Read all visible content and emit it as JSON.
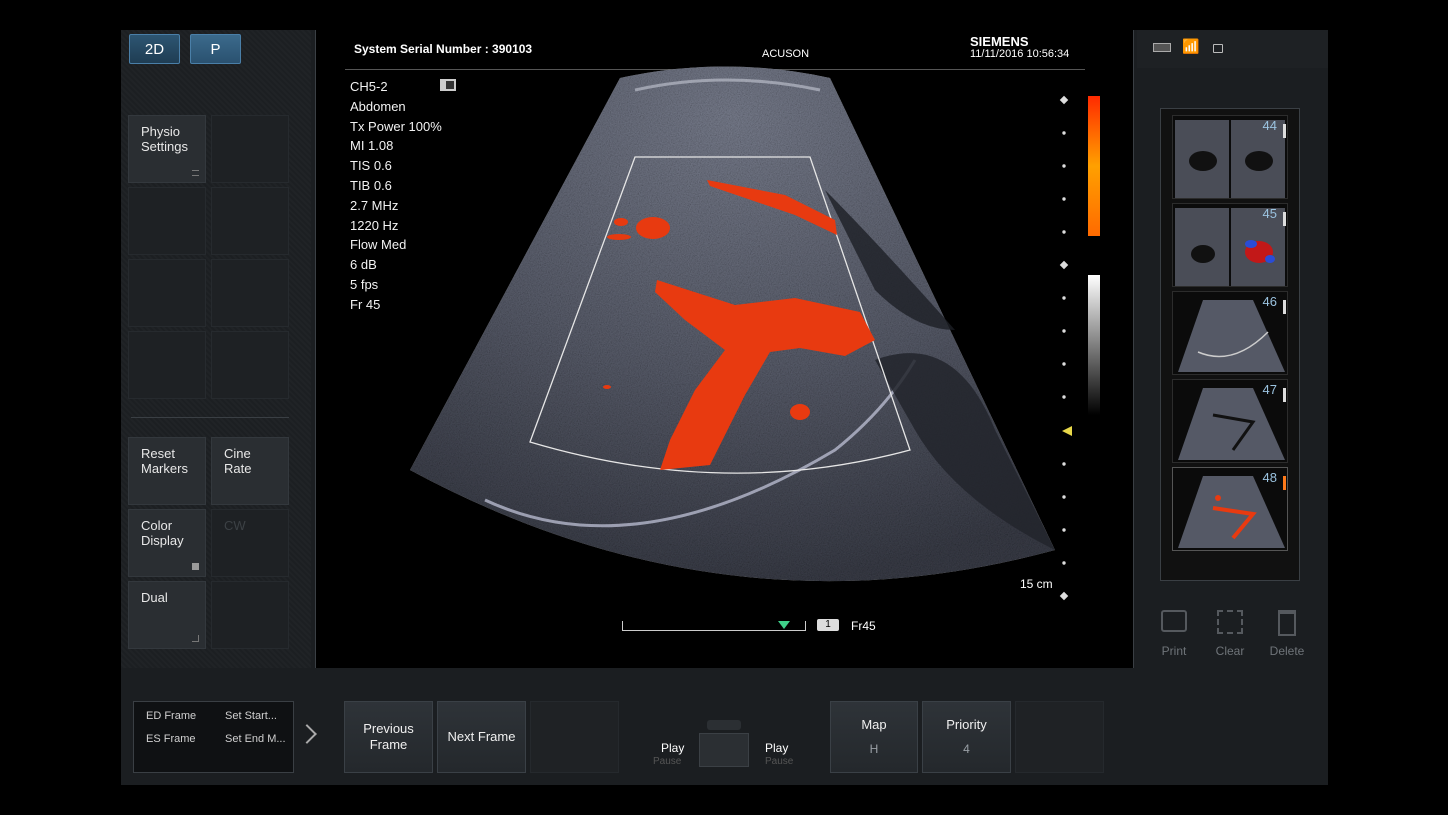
{
  "top_left": {
    "mode_2d": "2D",
    "mode_p": "P"
  },
  "left_panel": {
    "physio": "Physio Settings",
    "reset_markers": "Reset Markers",
    "cine_rate": "Cine Rate",
    "color_display": "Color Display",
    "cw": "CW",
    "dual": "Dual"
  },
  "header": {
    "serial": "System Serial Number : 390103",
    "product": "ACUSON",
    "brand": "SIEMENS",
    "datetime": "11/11/2016 10:56:34"
  },
  "params": [
    "CH5-2",
    "Abdomen",
    "Tx Power 100%",
    "MI 1.08",
    "TIS 0.6",
    "TIB 0.6",
    "2.7 MHz",
    "1220 Hz",
    "Flow Med",
    "6 dB",
    "5 fps",
    "Fr 45"
  ],
  "depth_label": "15 cm",
  "cine": {
    "marker": "1",
    "frame_label": "Fr45"
  },
  "thumbnails": [
    {
      "num": "44",
      "kind": "dual-bw"
    },
    {
      "num": "45",
      "kind": "dual-color"
    },
    {
      "num": "46",
      "kind": "liver-bw"
    },
    {
      "num": "47",
      "kind": "liver-bw"
    },
    {
      "num": "48",
      "kind": "liver-color"
    }
  ],
  "right_actions": {
    "print": "Print",
    "clear": "Clear",
    "delete": "Delete"
  },
  "bottom": {
    "ed_frame": "ED Frame",
    "set_start": "Set Start...",
    "es_frame": "ES Frame",
    "set_end": "Set End M...",
    "previous_frame": "Previous Frame",
    "next_frame": "Next Frame",
    "play_left": "Play",
    "pause_left": "Pause",
    "play_right": "Play",
    "pause_right": "Pause",
    "map": "Map",
    "map_value": "H",
    "priority": "Priority",
    "priority_value": "4"
  },
  "colors": {
    "accent_blue": "#2d5572",
    "doppler_red": "#e83a10",
    "panel": "#1b1e21"
  }
}
